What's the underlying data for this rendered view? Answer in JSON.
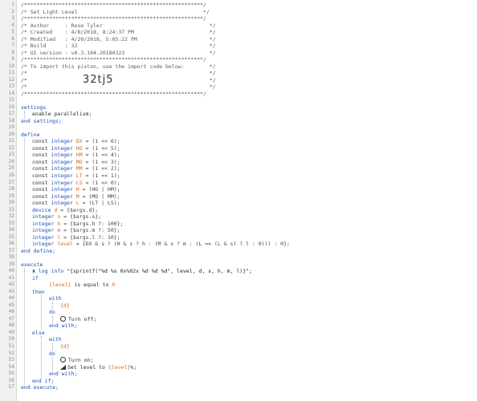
{
  "header": {
    "border": "/*********************************************************/",
    "title_line": "/* Set Light Level                                        */",
    "author": "/* Author     : Rose Tyler                                  */",
    "created": "/* Created    : 4/8/2018, 8:24:37 PM                        */",
    "modified": "/* Modified   : 4/20/2018, 5:05:22 PM                       */",
    "build": "/* Build      : 32                                          */",
    "ui_version": "/* UI version : v0.3.104.20180323                           */",
    "import_line": "/* To import this piston, use the import code below:        */",
    "blank1": "/*                                                          */",
    "blank2": "/*                                                          */",
    "blank3": "/*                                                          */",
    "import_code": "32tj5"
  },
  "code": {
    "settings": "settings",
    "enable_parallelism": "enable parallelism;",
    "end_settings": "end settings;",
    "define": "define",
    "end_define": "end define;",
    "execute": "execute",
    "end_execute": "end execute;",
    "const": "const",
    "integer": "integer",
    "device": "device",
    "if": "if",
    "then": "then",
    "else": "else",
    "end_if": "end if;",
    "with": "with",
    "do": "do",
    "end_with": "end with;"
  },
  "defines": [
    {
      "name": "DX",
      "value": "= (1 << 6);"
    },
    {
      "name": "HO",
      "value": "= (1 << 5);"
    },
    {
      "name": "HM",
      "value": "= (1 << 4);"
    },
    {
      "name": "MO",
      "value": "= (1 << 3);"
    },
    {
      "name": "MM",
      "value": "= (1 << 2);"
    },
    {
      "name": "LT",
      "value": "= (1 << 1);"
    },
    {
      "name": "LS",
      "value": "= (1 << 0);"
    },
    {
      "name": "H",
      "value": "= (HO | HM);"
    },
    {
      "name": "M",
      "value": "= (MO | MM);"
    },
    {
      "name": "L",
      "value": "= (LT | LS);"
    }
  ],
  "device_line": {
    "name": "d",
    "value": "= {$args.d};"
  },
  "vars": [
    {
      "name": "s",
      "value": "= {$args.s};"
    },
    {
      "name": "h",
      "value": "= {$args.h ?: 100};"
    },
    {
      "name": "m",
      "value": "= {$args.m ?: 50};"
    },
    {
      "name": "l",
      "value": "= {$args.l ?: 10};"
    },
    {
      "name": "level",
      "value": "= {DX & s ? (H & s ? h : (M & s ? m : (L == (L & s) ? l : 0))) : 0};"
    }
  ],
  "exec": {
    "log_label": "log",
    "log_level": "info",
    "log_text": "\"{sprintf(\"%d %s 0x%02x %d %d %d\", level, d, s, h, m, l)}\";",
    "cond_var": "{level}",
    "cond_text": "is equal to",
    "cond_val": "0",
    "dev1": "{d}",
    "turn_off": "Turn off;",
    "dev2": "{d}",
    "turn_on": "Turn on;",
    "set_level": "Set level to",
    "set_level_var": "{level}",
    "set_level_end": "%;"
  }
}
